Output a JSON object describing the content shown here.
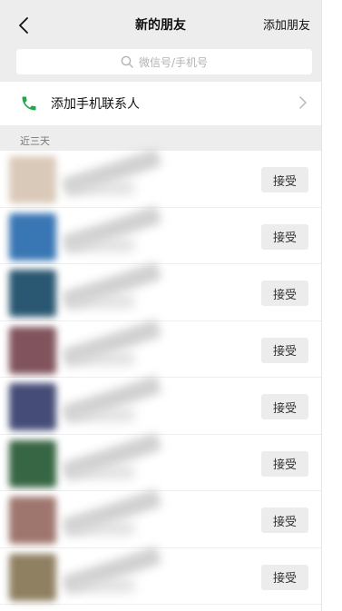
{
  "header": {
    "title": "新的朋友",
    "action_label": "添加朋友"
  },
  "search": {
    "placeholder": "微信号/手机号"
  },
  "add_contacts": {
    "label": "添加手机联系人"
  },
  "section": {
    "label": "近三天"
  },
  "requests": [
    {
      "avatar_color": "#d8c7b6",
      "accept_label": "接受"
    },
    {
      "avatar_color": "#2f6fb0",
      "accept_label": "接受"
    },
    {
      "avatar_color": "#1f4f6a",
      "accept_label": "接受"
    },
    {
      "avatar_color": "#7b4b55",
      "accept_label": "接受"
    },
    {
      "avatar_color": "#3c4370",
      "accept_label": "接受"
    },
    {
      "avatar_color": "#2d5e3a",
      "accept_label": "接受"
    },
    {
      "avatar_color": "#9a6f66",
      "accept_label": "接受"
    },
    {
      "avatar_color": "#8a7a5a",
      "accept_label": "接受"
    }
  ],
  "colors": {
    "bar_bg": "#ededed",
    "phone_green": "#22a84a",
    "accept_bg": "#ececec"
  }
}
